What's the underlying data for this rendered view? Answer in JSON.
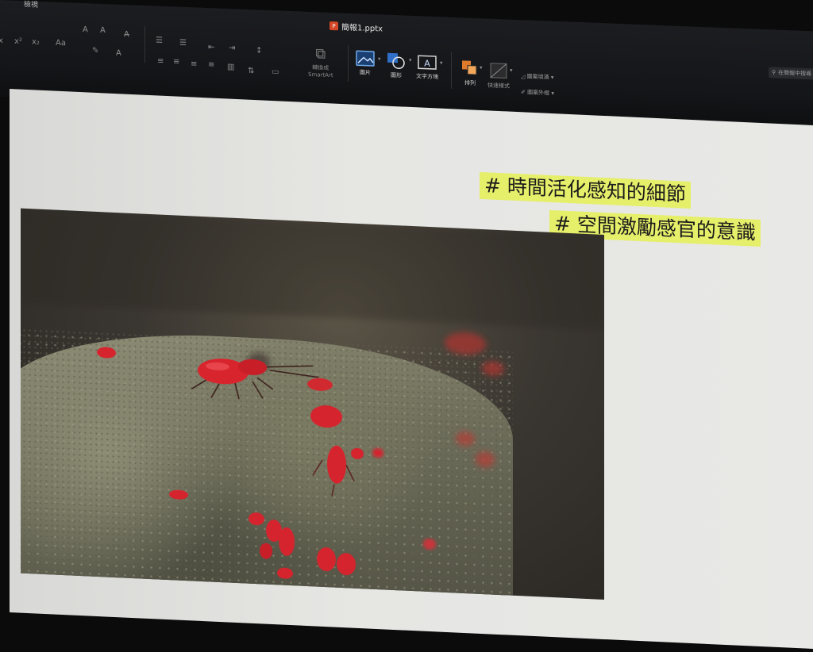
{
  "app": {
    "menu_item": "檢視",
    "doc_icon": "powerpoint-icon",
    "doc_title": "簡報1.pptx",
    "search_placeholder": "在簡報中搜尋",
    "ribbon": {
      "smartart_line1": "轉換成",
      "smartart_line2": "SmartArt",
      "picture_label": "圖片",
      "shape_label": "圖形",
      "textbox_label": "文字方塊",
      "arrange_label": "排列",
      "quick_styles_label": "快速樣式",
      "shape_fill_label": "圖案填滿",
      "shape_outline_label": "圖案外框"
    }
  },
  "slide": {
    "tag1": "# 時間活化感知的細節",
    "tag2": "# 空間激勵感官的意識",
    "tag_highlight_color": "#e6ef6a"
  }
}
